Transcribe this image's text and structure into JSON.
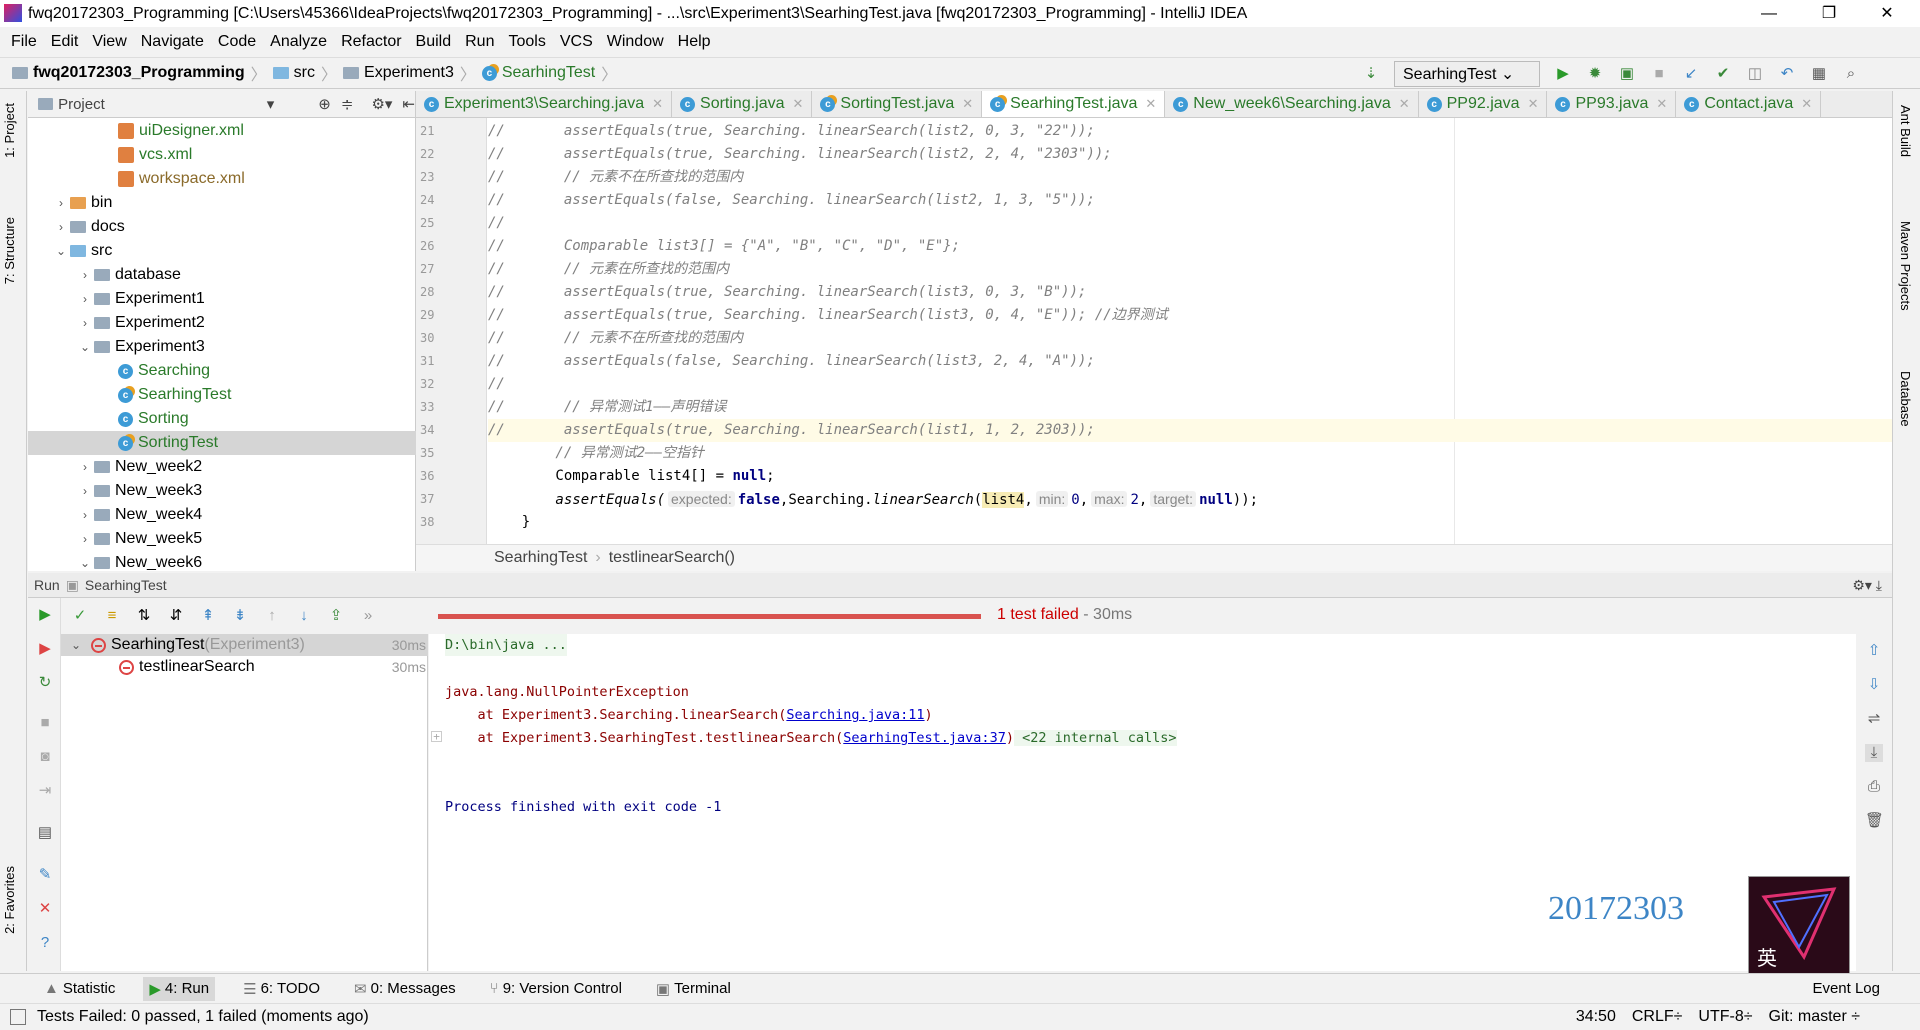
{
  "window": {
    "title": "fwq20172303_Programming [C:\\Users\\45366\\IdeaProjects\\fwq20172303_Programming] - ...\\src\\Experiment3\\SearhingTest.java [fwq20172303_Programming] - IntelliJ IDEA",
    "minimize": "—",
    "restore": "❐",
    "close": "✕"
  },
  "menu": [
    "File",
    "Edit",
    "View",
    "Navigate",
    "Code",
    "Analyze",
    "Refactor",
    "Build",
    "Run",
    "Tools",
    "VCS",
    "Window",
    "Help"
  ],
  "nav": {
    "crumbs": [
      "fwq20172303_Programming",
      "src",
      "Experiment3",
      "SearhingTest"
    ],
    "run_config": "SearhingTest"
  },
  "left_strip": [
    "1: Project",
    "7: Structure",
    "2: Favorites"
  ],
  "right_strip": [
    "Ant Build",
    "Maven Projects",
    "Database"
  ],
  "project": {
    "header": "Project",
    "items": [
      {
        "label": "uiDesigner.xml",
        "type": "xml",
        "depth": 3,
        "arrow": ""
      },
      {
        "label": "vcs.xml",
        "type": "xml",
        "depth": 3,
        "arrow": ""
      },
      {
        "label": "workspace.xml",
        "type": "xml",
        "depth": 3,
        "arrow": ""
      },
      {
        "label": "bin",
        "type": "folder-orange",
        "depth": 1,
        "arrow": "›"
      },
      {
        "label": "docs",
        "type": "folder",
        "depth": 1,
        "arrow": "›"
      },
      {
        "label": "src",
        "type": "folder-blue",
        "depth": 1,
        "arrow": "⌄"
      },
      {
        "label": "database",
        "type": "folder",
        "depth": 2,
        "arrow": "›"
      },
      {
        "label": "Experiment1",
        "type": "folder",
        "depth": 2,
        "arrow": "›"
      },
      {
        "label": "Experiment2",
        "type": "folder",
        "depth": 2,
        "arrow": "›"
      },
      {
        "label": "Experiment3",
        "type": "folder",
        "depth": 2,
        "arrow": "⌄"
      },
      {
        "label": "Searching",
        "type": "class",
        "depth": 3,
        "arrow": ""
      },
      {
        "label": "SearhingTest",
        "type": "test",
        "depth": 3,
        "arrow": ""
      },
      {
        "label": "Sorting",
        "type": "class",
        "depth": 3,
        "arrow": ""
      },
      {
        "label": "SortingTest",
        "type": "test",
        "depth": 3,
        "arrow": "",
        "selected": true
      },
      {
        "label": "New_week2",
        "type": "folder",
        "depth": 2,
        "arrow": "›"
      },
      {
        "label": "New_week3",
        "type": "folder",
        "depth": 2,
        "arrow": "›"
      },
      {
        "label": "New_week4",
        "type": "folder",
        "depth": 2,
        "arrow": "›"
      },
      {
        "label": "New_week5",
        "type": "folder",
        "depth": 2,
        "arrow": "›"
      },
      {
        "label": "New_week6",
        "type": "folder",
        "depth": 2,
        "arrow": "⌄"
      }
    ]
  },
  "tabs": [
    {
      "label": "Experiment3\\Searching.java",
      "active": false
    },
    {
      "label": "Sorting.java",
      "active": false
    },
    {
      "label": "SortingTest.java",
      "active": false
    },
    {
      "label": "SearhingTest.java",
      "active": true
    },
    {
      "label": "New_week6\\Searching.java",
      "active": false
    },
    {
      "label": "PP92.java",
      "active": false
    },
    {
      "label": "PP93.java",
      "active": false
    },
    {
      "label": "Contact.java",
      "active": false
    }
  ],
  "code": [
    {
      "n": "21",
      "t": "//       assertEquals(true, Searching. linearSearch(list2, 0, 3, \"22\"));",
      "c": "cm"
    },
    {
      "n": "22",
      "t": "//       assertEquals(true, Searching. linearSearch(list2, 2, 4, \"2303\"));",
      "c": "cm"
    },
    {
      "n": "23",
      "t": "//       // 元素不在所查找的范围内",
      "c": "cm"
    },
    {
      "n": "24",
      "t": "//       assertEquals(false, Searching. linearSearch(list2, 1, 3, \"5\"));",
      "c": "cm"
    },
    {
      "n": "25",
      "t": "//",
      "c": "cm"
    },
    {
      "n": "26",
      "t": "//       Comparable list3[] = {\"A\", \"B\", \"C\", \"D\", \"E\"};",
      "c": "cm"
    },
    {
      "n": "27",
      "t": "//       // 元素在所查找的范围内",
      "c": "cm"
    },
    {
      "n": "28",
      "t": "//       assertEquals(true, Searching. linearSearch(list3, 0, 3, \"B\"));",
      "c": "cm"
    },
    {
      "n": "29",
      "t": "//       assertEquals(true, Searching. linearSearch(list3, 0, 4, \"E\")); //边界测试",
      "c": "cm"
    },
    {
      "n": "30",
      "t": "//       // 元素不在所查找的范围内",
      "c": "cm"
    },
    {
      "n": "31",
      "t": "//       assertEquals(false, Searching. linearSearch(list3, 2, 4, \"A\"));",
      "c": "cm"
    },
    {
      "n": "32",
      "t": "//",
      "c": "cm"
    },
    {
      "n": "33",
      "t": "//       // 异常测试1——声明错误",
      "c": "cm"
    },
    {
      "n": "34",
      "t": "//       assertEquals(true, Searching. linearSearch(list1, 1, 2, 2303));",
      "c": "cm",
      "hl": true
    },
    {
      "n": "35",
      "t": "        // 异常测试2——空指针",
      "c": "cm"
    },
    {
      "n": "36",
      "t": "",
      "c": ""
    },
    {
      "n": "37",
      "t": "",
      "c": ""
    },
    {
      "n": "38",
      "t": "    }",
      "c": ""
    }
  ],
  "line36": {
    "pre": "        Comparable list4[] = ",
    "kw": "null",
    "post": ";"
  },
  "line37": {
    "fn": "        assertEquals(",
    "h1": "expected:",
    "v1": "false",
    ", ": ",",
    "call": "Searching.",
    "m": "linearSearch",
    "p": "(",
    "var": "list4",
    ",": ",",
    "h2": "min:",
    "v2": "0",
    "h3": "max:",
    "v3": "2",
    "h4": "target:",
    "v4": "null",
    "end": "));"
  },
  "editor_breadcrumb": [
    "SearhingTest",
    "testlinearSearch()"
  ],
  "run": {
    "label": "Run",
    "config": "SearhingTest",
    "status": "1 test failed",
    "duration": " - 30ms",
    "progress_failed_fraction": 1.0,
    "tree": [
      {
        "label": "SearhingTest",
        "sub": " (Experiment3)",
        "time": "30ms",
        "status": "failed"
      },
      {
        "label": "testlinearSearch",
        "sub": "",
        "time": "30ms",
        "status": "failed"
      }
    ],
    "console": {
      "cmd": "D:\\bin\\java ...",
      "exc": "java.lang.NullPointerException",
      "at1_pre": "    at Experiment3.Searching.linearSearch(",
      "at1_link": "Searching.java:11",
      "at1_post": ")",
      "at2_pre": "    at Experiment3.SearhingTest.testlinearSearch(",
      "at2_link": "SearhingTest.java:37",
      "at2_post": ")",
      "internal": " <22 internal calls>",
      "exit": "Process finished with exit code -1"
    }
  },
  "watermark": "20172303",
  "bottom_tabs": [
    "Statistic",
    "4: Run",
    "6: TODO",
    "0: Messages",
    "9: Version Control",
    "Terminal"
  ],
  "event_log": "Event Log",
  "status": {
    "message": "Tests Failed: 0 passed, 1 failed (moments ago)",
    "position": "34:50",
    "line_sep": "CRLF÷",
    "encoding": "UTF-8÷",
    "git": "Git: master ÷"
  }
}
